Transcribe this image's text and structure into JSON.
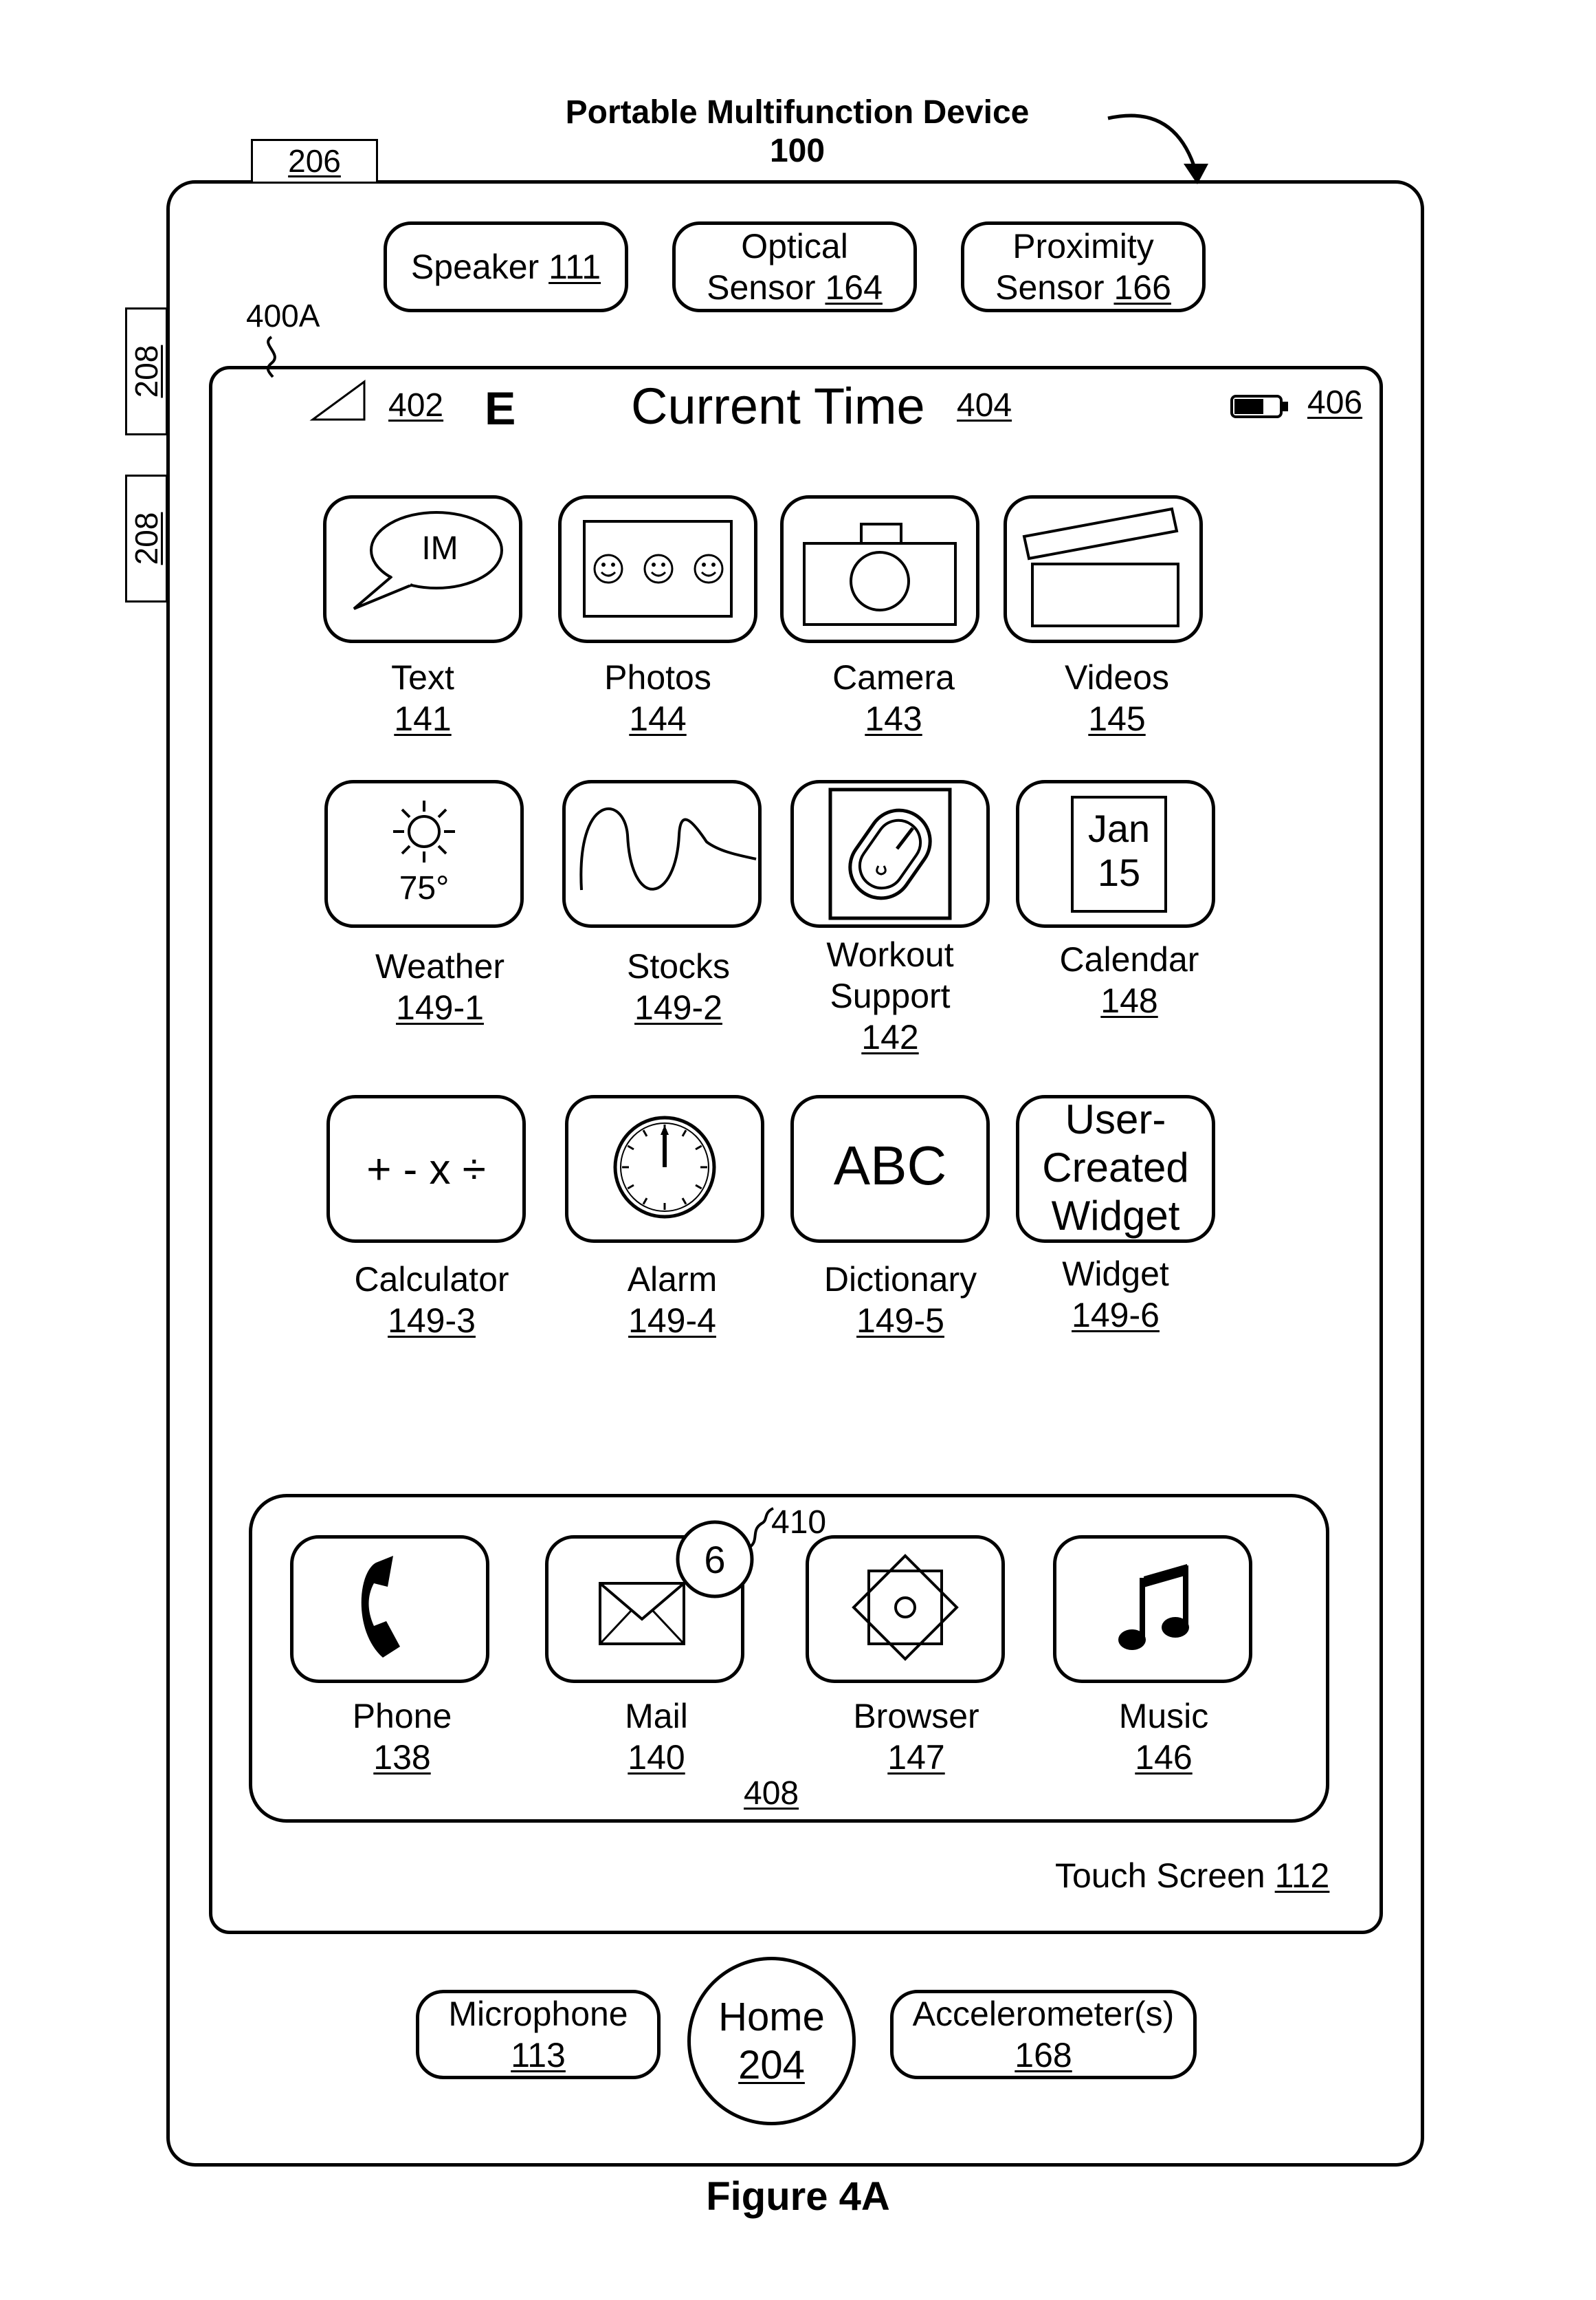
{
  "title": {
    "line1": "Portable Multifunction Device",
    "line2": "100"
  },
  "figure_caption": "Figure 4A",
  "device_refs": {
    "top_tab": "206",
    "side_button_1": "208",
    "side_button_2": "208",
    "screen_ref": "400A"
  },
  "sensors_top": [
    {
      "line1": "Speaker",
      "ref": "111"
    },
    {
      "line1": "Optical",
      "line2": "Sensor",
      "ref": "164"
    },
    {
      "line1": "Proximity",
      "line2": "Sensor",
      "ref": "166"
    }
  ],
  "status_bar": {
    "signal_ref": "402",
    "network": "E",
    "time_label": "Current Time",
    "time_ref": "404",
    "battery_ref": "406"
  },
  "apps": [
    {
      "name": "Text",
      "ref": "141",
      "icon": "im-bubble-icon",
      "icon_text": "IM"
    },
    {
      "name": "Photos",
      "ref": "144",
      "icon": "photos-icon"
    },
    {
      "name": "Camera",
      "ref": "143",
      "icon": "camera-icon"
    },
    {
      "name": "Videos",
      "ref": "145",
      "icon": "clapperboard-icon"
    },
    {
      "name": "Weather",
      "ref": "149-1",
      "icon": "sun-icon",
      "icon_text": "75°"
    },
    {
      "name": "Stocks",
      "ref": "149-2",
      "icon": "stock-wave-icon"
    },
    {
      "name_line1": "Workout",
      "name_line2": "Support",
      "ref": "142",
      "icon": "workout-icon"
    },
    {
      "name": "Calendar",
      "ref": "148",
      "icon": "calendar-icon",
      "icon_line1": "Jan",
      "icon_line2": "15"
    },
    {
      "name": "Calculator",
      "ref": "149-3",
      "icon": "calculator-icon",
      "icon_text": "+ - x ÷"
    },
    {
      "name": "Alarm",
      "ref": "149-4",
      "icon": "clock-icon"
    },
    {
      "name": "Dictionary",
      "ref": "149-5",
      "icon": "dictionary-icon",
      "icon_text": "ABC"
    },
    {
      "name": "Widget",
      "ref": "149-6",
      "icon": "widget-icon",
      "icon_line1": "User-",
      "icon_line2": "Created",
      "icon_line3": "Widget"
    }
  ],
  "dock": {
    "ref": "408",
    "badge": {
      "count": "6",
      "ref": "410"
    },
    "apps": [
      {
        "name": "Phone",
        "ref": "138",
        "icon": "phone-icon"
      },
      {
        "name": "Mail",
        "ref": "140",
        "icon": "envelope-icon"
      },
      {
        "name": "Browser",
        "ref": "147",
        "icon": "compass-icon"
      },
      {
        "name": "Music",
        "ref": "146",
        "icon": "music-note-icon"
      }
    ]
  },
  "touch_screen": {
    "label": "Touch Screen",
    "ref": "112"
  },
  "sensors_bottom": [
    {
      "line1": "Microphone",
      "ref": "113"
    },
    {
      "line1": "Home",
      "ref": "204"
    },
    {
      "line1": "Accelerometer(s)",
      "ref": "168"
    }
  ]
}
